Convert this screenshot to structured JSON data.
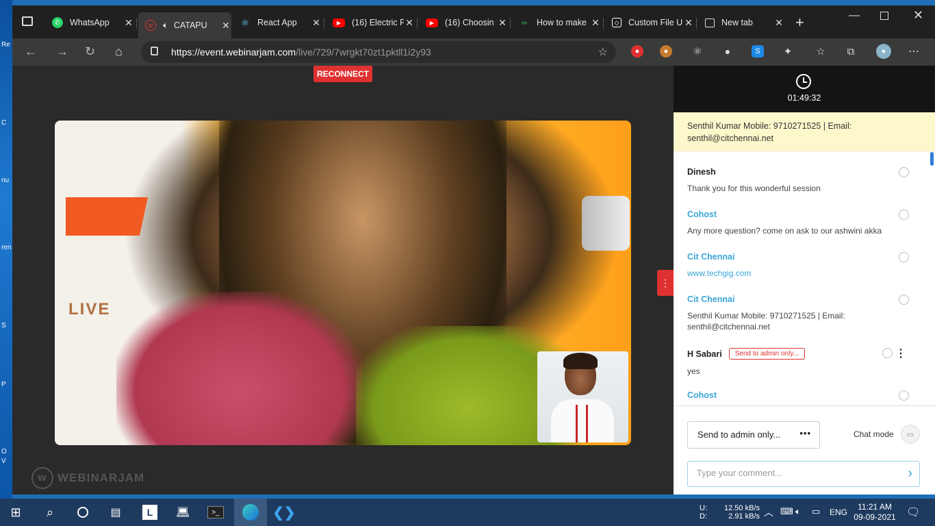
{
  "desktop": {
    "labels": [
      "Re",
      "C",
      "nu",
      "ren",
      "S",
      "P",
      "O",
      "V"
    ]
  },
  "tabs": [
    {
      "title": "WhatsApp",
      "favicon": "whatsapp-icon",
      "color": "#25d366"
    },
    {
      "title": "CATAPU",
      "favicon": "webinarjam-icon",
      "color": "#e03131",
      "active": true,
      "audio": true
    },
    {
      "title": "React App",
      "favicon": "react-icon",
      "color": "#61dafb"
    },
    {
      "title": "(16) Electric P",
      "favicon": "youtube-icon",
      "color": "#ff0000"
    },
    {
      "title": "(16) Choosin",
      "favicon": "youtube-icon",
      "color": "#ff0000"
    },
    {
      "title": "How to make",
      "favicon": "geeks-icon",
      "color": "#2f8d46"
    },
    {
      "title": "Custom File U",
      "favicon": "codepen-icon",
      "color": "#ffffff"
    },
    {
      "title": "New tab",
      "favicon": "newtab-icon",
      "color": "#ffffff"
    }
  ],
  "address": {
    "host": "https://event.webinarjam.com",
    "path": "/live/729/7wrgkt70zt1pktll1i2y93"
  },
  "stage": {
    "reconnect_label": "RECONNECT",
    "video_live_text": "LIVE",
    "brand": "WEBINARJAM"
  },
  "panel": {
    "timer": "01:49:32",
    "pinned": "Senthil Kumar Mobile: 9710271525 | Email: senthil@citchennai.net",
    "messages": [
      {
        "name": "Dinesh",
        "text": "Thank you for this wonderful session",
        "name_color": "dark"
      },
      {
        "name": "Cohost",
        "text": "Any more question? come on ask to our ashwini akka",
        "name_color": "blue"
      },
      {
        "name": "Cit Chennai",
        "text": "www.techgig.com",
        "name_color": "blue",
        "link": true
      },
      {
        "name": "Cit Chennai",
        "text": "Senthil Kumar Mobile: 9710271525 | Email: senthil@citchennai.net",
        "name_color": "blue"
      },
      {
        "name": "H Sabari",
        "badge": "Send to admin only...",
        "text": "yes",
        "name_color": "dark"
      },
      {
        "name": "Cohost",
        "text": "",
        "name_color": "blue"
      }
    ],
    "send_select": "Send to admin only...",
    "send_select_more": "•••",
    "chat_mode_label": "Chat mode",
    "comment_placeholder": "Type your comment..."
  },
  "taskbar": {
    "net_up_label": "U:",
    "net_down_label": "D:",
    "net_up": "12.50 kB/s",
    "net_down": "2.91 kB/s",
    "lang": "ENG",
    "time": "11:21 AM",
    "date": "09-09-2021"
  }
}
